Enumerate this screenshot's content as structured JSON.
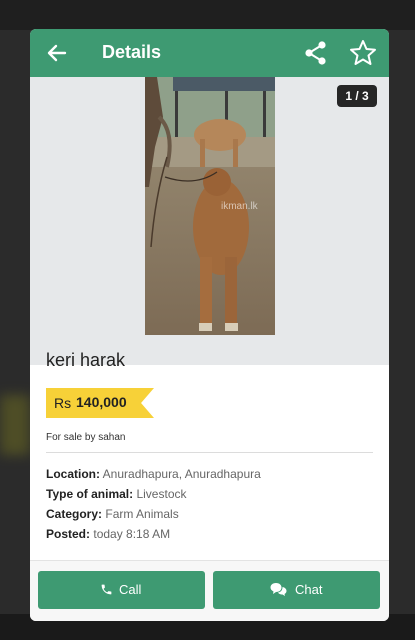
{
  "header": {
    "title": "Details",
    "back_icon": "arrow-left-icon",
    "share_icon": "share-icon",
    "favorite_icon": "star-outline-icon"
  },
  "gallery": {
    "counter": "1 / 3",
    "watermark": "ikman.lk"
  },
  "listing": {
    "title": "keri harak",
    "price_currency": "Rs",
    "price_value": "140,000",
    "seller": "For sale by sahan"
  },
  "details": [
    {
      "label": "Location:",
      "value": "Anuradhapura, Anuradhapura"
    },
    {
      "label": "Type of animal:",
      "value": "Livestock"
    },
    {
      "label": "Category:",
      "value": "Farm Animals"
    },
    {
      "label": "Posted:",
      "value": "today 8:18 AM"
    }
  ],
  "actions": {
    "call_label": "Call",
    "chat_label": "Chat",
    "call_icon": "phone-icon",
    "chat_icon": "chat-bubbles-icon"
  },
  "colors": {
    "brand_green": "#3e9a72",
    "price_badge": "#f7d138",
    "counter_bg": "#262626"
  }
}
